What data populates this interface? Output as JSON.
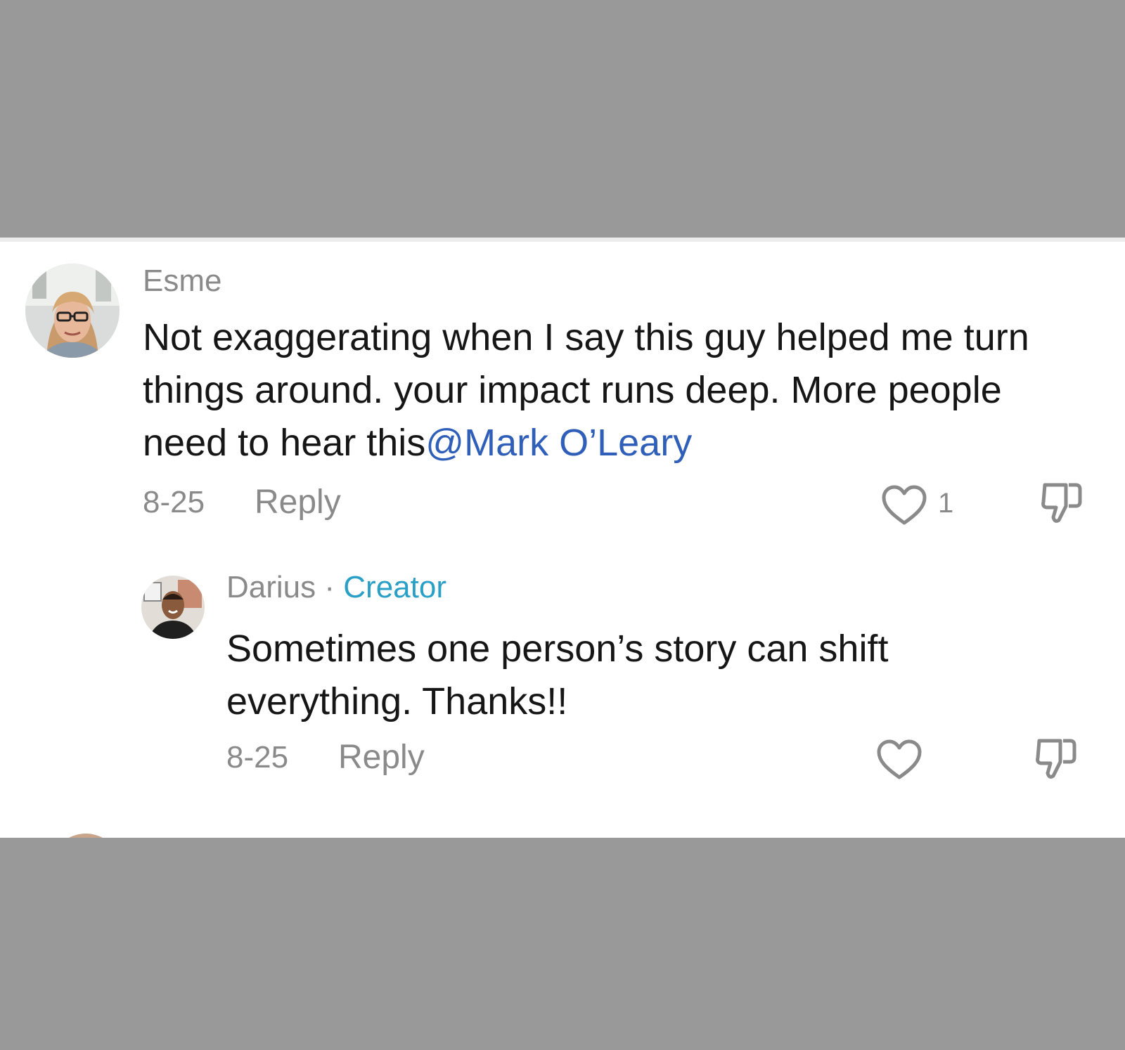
{
  "comments": [
    {
      "username": "Esme",
      "text_before_mention": "Not exaggerating when I say this guy helped me turn things around. your impact runs deep. More people need to hear this",
      "mention": "@Mark O’Leary",
      "date": "8-25",
      "reply_label": "Reply",
      "like_count": "1",
      "icons": {
        "avatar": "avatar-esme",
        "like": "heart-outline-icon",
        "dislike": "thumbs-down-icon"
      }
    },
    {
      "username": "Darius",
      "separator": "·",
      "badge": "Creator",
      "text": "Sometimes one person’s story can shift everything. Thanks!!",
      "date": "8-25",
      "reply_label": "Reply",
      "icons": {
        "avatar": "avatar-darius",
        "like": "heart-outline-icon",
        "dislike": "thumbs-down-icon"
      }
    }
  ],
  "colors": {
    "background_band": "#999999",
    "panel": "#ffffff",
    "mention": "#2f5fb8",
    "creator_badge": "#2aa0c7",
    "meta_text": "#8a8a8a",
    "body_text": "#161616"
  }
}
